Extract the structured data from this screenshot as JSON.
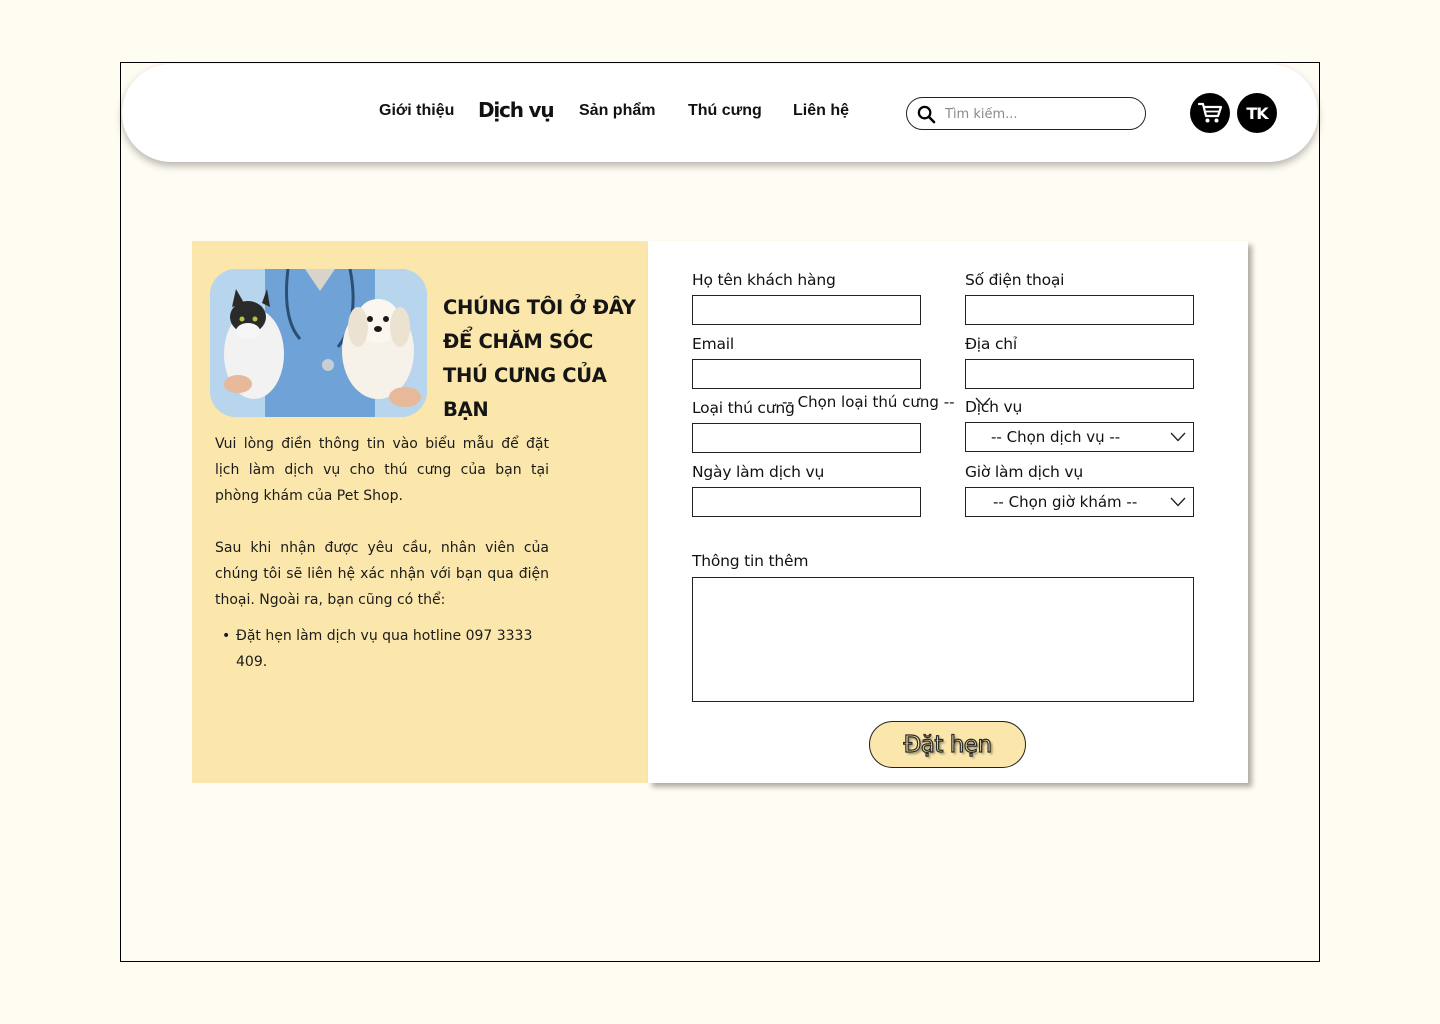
{
  "nav": {
    "links": [
      "Giới thiệu",
      "Dịch vụ",
      "Sản phẩm",
      "Thú cưng",
      "Liên hệ"
    ],
    "active": "Dịch vụ",
    "search_placeholder": "Tìm kiếm...",
    "account_label": "TK"
  },
  "intro": {
    "headline": "CHÚNG TÔI Ở ĐÂY ĐỂ CHĂM SÓC THÚ CƯNG CỦA BẠN",
    "paragraph1": "Vui lòng điền thông tin vào biểu mẫu để đặt lịch làm dịch vụ cho thú cưng của bạn tại phòng khám của Pet Shop.",
    "paragraph2": "Sau khi nhận được yêu cầu, nhân viên của chúng tôi sẽ liên hệ xác nhận với bạn qua điện thoại. Ngoài ra, bạn cũng có thể:",
    "bullet": "Đặt hẹn làm dịch vụ qua hotline 097 3333 409."
  },
  "form": {
    "name_label": "Họ tên khách hàng",
    "phone_label": "Số điện thoại",
    "email_label": "Email",
    "address_label": "Địa chỉ",
    "pet_type_label": "Loại thú cưng",
    "pet_type_placeholder": "-- Chọn loại thú cưng --",
    "service_label": "Dịch vụ",
    "service_placeholder": "-- Chọn dịch vụ --",
    "date_label": "Ngày làm dịch vụ",
    "time_label": "Giờ làm dịch vụ",
    "time_placeholder": "-- Chọn giờ khám --",
    "notes_label": "Thông tin thêm",
    "submit_label": "Đặt hẹn"
  },
  "colors": {
    "page_bg": "#fffcf2",
    "panel_yellow": "#fbe7ab",
    "black": "#000000"
  },
  "icons": [
    "search-icon",
    "cart-icon",
    "chevron-down-icon"
  ]
}
